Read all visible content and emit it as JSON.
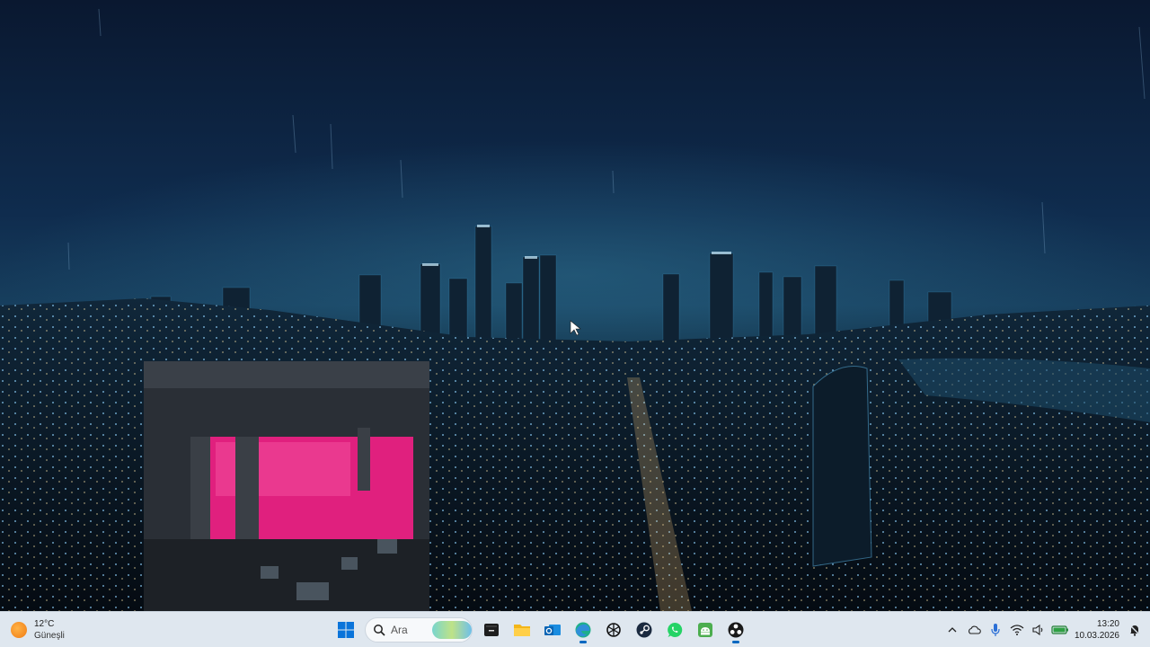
{
  "desktop": {
    "wallpaper": "night-city-skyline-rain"
  },
  "taskbar": {
    "weather": {
      "temperature": "12°C",
      "condition": "Güneşli",
      "icon": "sun-icon"
    },
    "start_icon": "windows-start-icon",
    "search": {
      "placeholder": "Ara"
    },
    "apps": [
      {
        "name": "terminal-icon",
        "active": false
      },
      {
        "name": "file-explorer-icon",
        "active": false
      },
      {
        "name": "outlook-icon",
        "active": false
      },
      {
        "name": "edge-browser-icon",
        "active": true
      },
      {
        "name": "chatgpt-icon",
        "active": false
      },
      {
        "name": "steam-icon",
        "active": false
      },
      {
        "name": "whatsapp-icon",
        "active": false
      },
      {
        "name": "android-app-icon",
        "active": false
      },
      {
        "name": "obs-studio-icon",
        "active": true
      }
    ],
    "tray": {
      "icons": [
        "chevron-up-icon",
        "onedrive-cloud-icon",
        "microphone-icon",
        "wifi-icon",
        "speaker-icon",
        "battery-icon"
      ],
      "time": "13:20",
      "date": "10.03.2026",
      "notification_icon": "notification-bell-icon"
    },
    "colors": {
      "taskbar_bg": "#dfe7ef",
      "accent": "#0067c0"
    }
  }
}
